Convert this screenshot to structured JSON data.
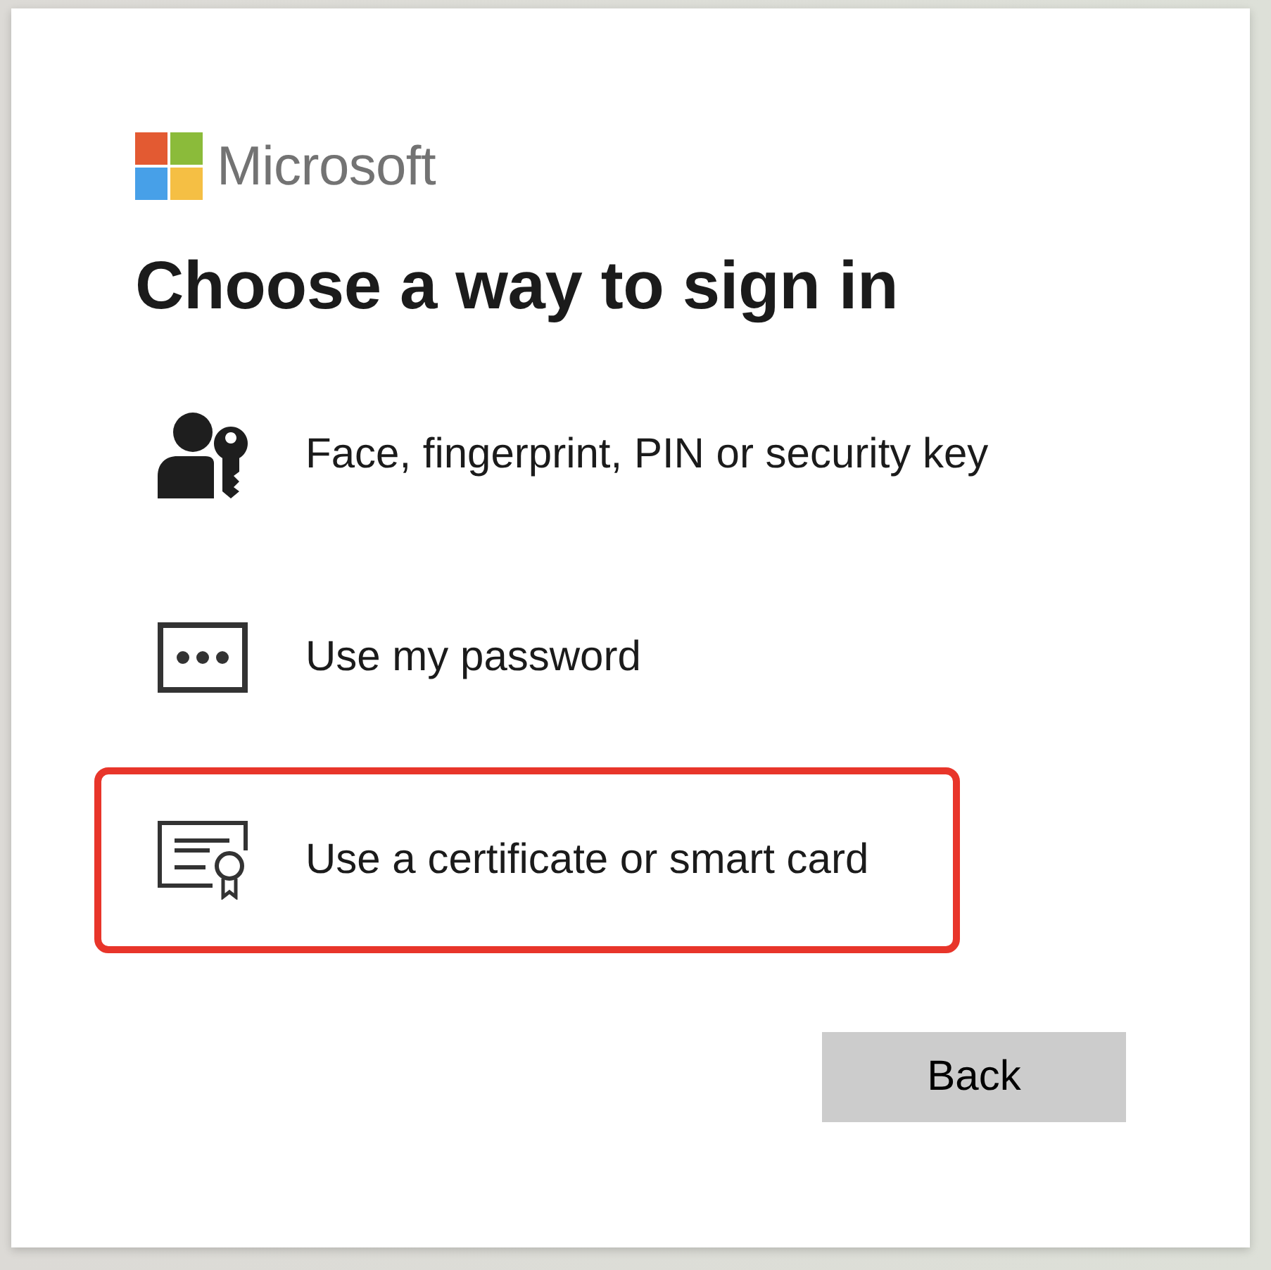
{
  "logo": {
    "text": "Microsoft"
  },
  "title": "Choose a way to sign in",
  "options": [
    {
      "kind": "passkey",
      "label": "Face, fingerprint, PIN or security key",
      "highlighted": false
    },
    {
      "kind": "password",
      "label": "Use my password",
      "highlighted": false
    },
    {
      "kind": "certificate",
      "label": "Use a certificate or smart card",
      "highlighted": true
    }
  ],
  "buttons": [
    {
      "label": "Back"
    }
  ]
}
